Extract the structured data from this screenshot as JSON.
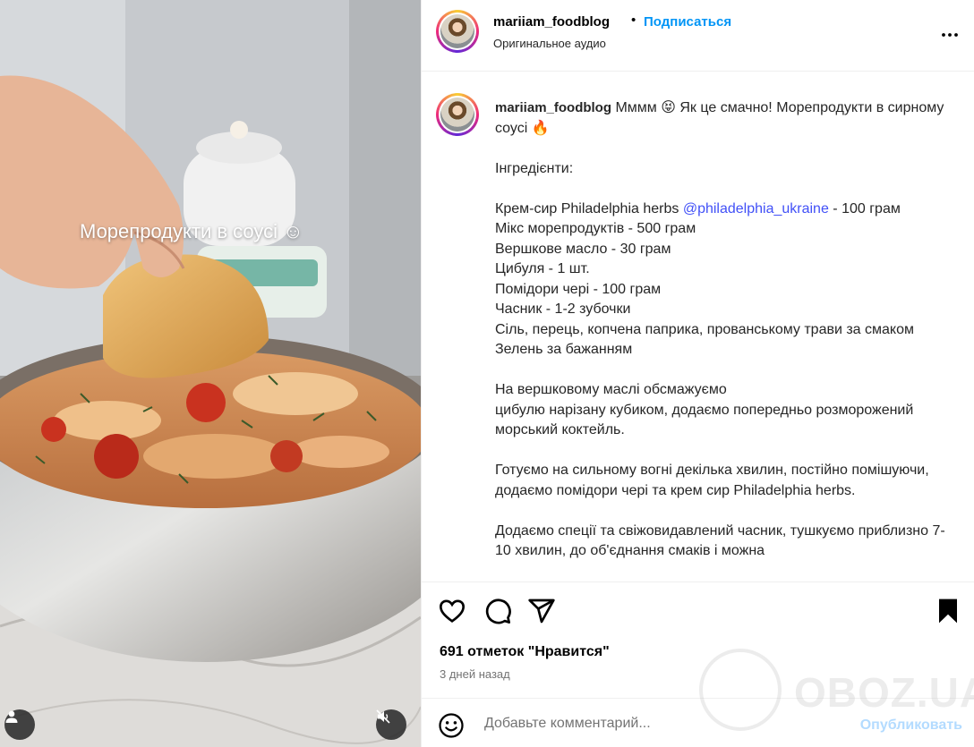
{
  "media": {
    "overlay_text": "Морепродукти в соусі ☺"
  },
  "header": {
    "username": "mariiam_foodblog",
    "separator": "•",
    "follow_label": "Подписаться",
    "audio_label": "Оригинальное аудио"
  },
  "caption": {
    "username": "mariiam_foodblog",
    "intro": " Мммм 😝 Як це смачно! Морепродукти в сирному соусі 🔥",
    "ingredients_title": "Інгредієнти:",
    "ingredient_1_prefix": "Крем-сир Philadelphia herbs ",
    "ingredient_1_mention": "@philadelphia_ukraine",
    "ingredient_1_suffix": " - 100 грам",
    "ingredient_2": "Мікс морепродуктів - 500 грам",
    "ingredient_3": "Вершкове масло - 30 грам",
    "ingredient_4": "Цибуля - 1 шт.",
    "ingredient_5": "Помідори чері - 100 грам",
    "ingredient_6": "Часник - 1-2 зубочки",
    "ingredient_7": "Сіль, перець, копчена паприка, прованському трави за смаком",
    "ingredient_8": "Зелень за бажанням",
    "step_1_line_1": "На вершковому маслі обсмажуємо",
    "step_1_line_2": "цибулю нарізану кубиком, додаємо попередньо розморожений морський коктейль.",
    "step_2": "Готуємо на сильному вогні декілька хвилин, постійно помішуючи, додаємо помідори чері та крем сир Philadelphia herbs.",
    "step_3": "Додаємо спеції та свіжовидавлений часник, тушкуємо приблизно 7-10 хвилин, до об'єднання смаків і можна"
  },
  "actions": {
    "likes_text": "691 отметок \"Нравится\"",
    "time_text": "3 дней назад"
  },
  "comment": {
    "placeholder": "Добавьте комментарий...",
    "publish_label": "Опубликовать"
  },
  "watermark": {
    "text": "OBOZ.UA"
  },
  "icons": {
    "like": "heart-icon",
    "comment": "comment-icon",
    "share": "paper-plane-icon",
    "save": "bookmark-icon",
    "more": "more-icon",
    "emoji": "emoji-icon",
    "user_tag": "user-icon",
    "mute": "muted-speaker-icon"
  },
  "colors": {
    "link_blue": "#0095f6",
    "mention_blue": "#4150f7",
    "publish_disabled": "#b3dbff",
    "muted_text": "#737373"
  }
}
